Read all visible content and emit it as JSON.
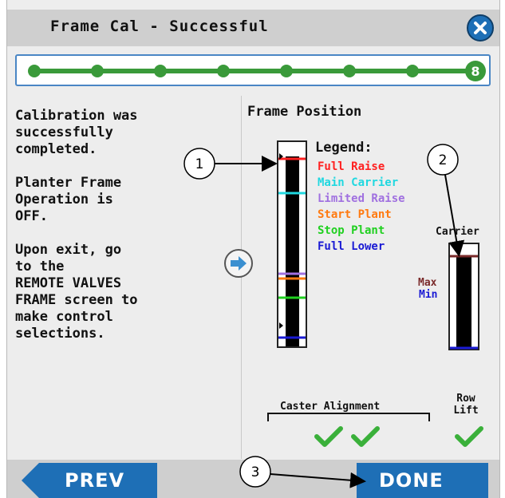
{
  "header": {
    "title": "Frame Cal - Successful",
    "close_icon": "close-icon"
  },
  "progress": {
    "current_step": 8,
    "total_steps": 8,
    "accent_color": "#3a9a3a"
  },
  "message": {
    "line1": "Calibration was\nsuccessfully\ncompleted.",
    "line2": "Planter Frame\nOperation is\nOFF.",
    "line3": "Upon exit, go\nto the\nREMOTE VALVES\nFRAME screen to\nmake control\nselections."
  },
  "frame_position": {
    "title": "Frame Position",
    "legend_title": "Legend:",
    "legend": [
      {
        "label": "Full Raise",
        "color": "#ff2020"
      },
      {
        "label": "Main Carrier",
        "color": "#20d8e0"
      },
      {
        "label": "Limited Raise",
        "color": "#a070e0"
      },
      {
        "label": "Start Plant",
        "color": "#ff7a10"
      },
      {
        "label": "Stop Plant",
        "color": "#20d020"
      },
      {
        "label": "Full Lower",
        "color": "#1a1ad4"
      }
    ],
    "carrier_label": "Carrier",
    "max_label": "Max",
    "min_label": "Min"
  },
  "alignment": {
    "caster_label": "Caster Alignment",
    "row_lift_label": "Row\nLift"
  },
  "callouts": [
    "1",
    "2",
    "3"
  ],
  "buttons": {
    "prev": "PREV",
    "done": "DONE"
  }
}
